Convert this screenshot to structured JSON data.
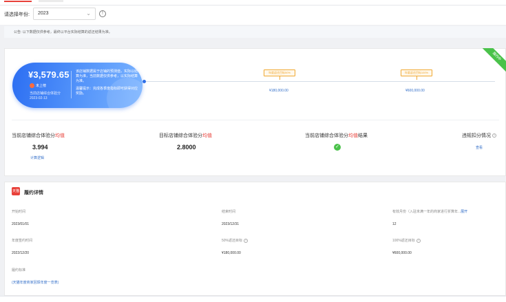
{
  "filter": {
    "year_label": "请选择年份:",
    "year_value": "2023"
  },
  "notice": "公告: 以下数据仅供参考，最终以平台实际结算的返还结果为准。",
  "summary": {
    "ribbon": "履约中",
    "amount": "¥3,579.65",
    "badge": "未上榜",
    "sub_line1": "当前店铺综合体验分",
    "sub_line2": "2023-02-13",
    "desc1": "该店铺数据属于店铺的预测值，实际以结算为准，当前数据仅供参考，以实际结算为准。",
    "desc2": "温馨提示：完成各季度指标即可获得对应奖励。"
  },
  "milestones": [
    {
      "tag": "年度返还目标50%",
      "value": "¥180,000.00"
    },
    {
      "tag": "年度返还目标100%",
      "value": "¥600,000.00"
    }
  ],
  "metrics": {
    "m1_title_pre": "当前店铺综合体验分",
    "m1_title_em": "均值",
    "m1_value": "3.994",
    "m1_link": "计算逻辑",
    "m2_title_pre": "目标店铺综合体验分",
    "m2_title_em": "均值",
    "m2_value": "2.8000",
    "m3_title_pre": "当前店铺综合体验分",
    "m3_title_em": "均值",
    "m3_title_post": "结果",
    "m4_title": "违规扣分情况",
    "m4_link": "查看"
  },
  "detail": {
    "section_title": "履约详情",
    "icon_text": "天猫",
    "start_label": "开始时间",
    "start_value": "2023/01/01",
    "end_label": "结束时间",
    "end_value": "2023/12/31",
    "months_label": "有效月份（入驻未满一年的商家进行折算年...",
    "months_link": "展开",
    "months_value": "12",
    "sign_label": "年度签约时间",
    "sign_value": "2022/12/20",
    "t50_label": "50%返还目标",
    "t50_value": "¥180,000.00",
    "t100_label": "100%返还目标",
    "t100_value": "¥600,000.00",
    "standard_label": "履约标准",
    "standard_link": "(天猫年度商家回馈年度一览表)"
  }
}
